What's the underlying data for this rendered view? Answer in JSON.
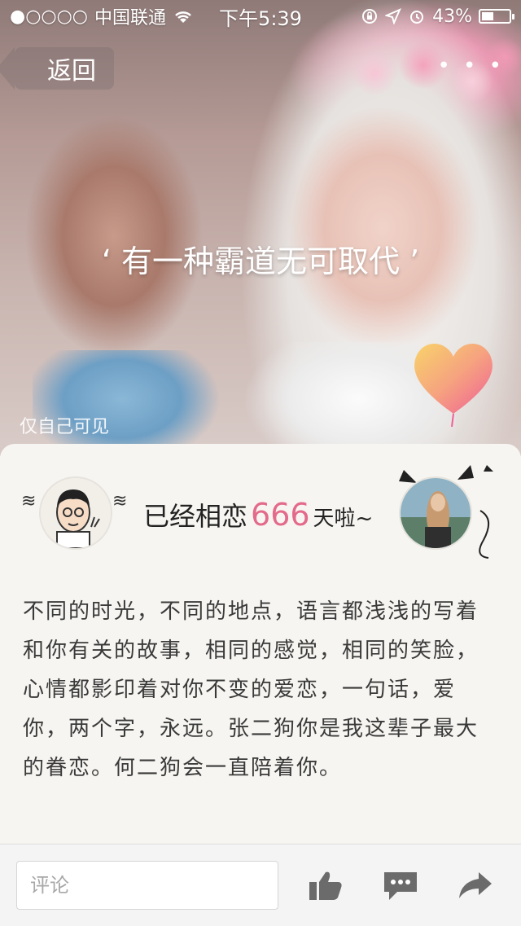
{
  "status_bar": {
    "signal": "●○○○○",
    "carrier": "中国联通",
    "wifi_icon": "wifi-icon",
    "time": "下午5:39",
    "battery_percent": "43%",
    "battery_level": 0.43
  },
  "header": {
    "back_label": "返回",
    "more_label": "• • •"
  },
  "photo": {
    "caption": "‘ 有一种霸道无可取代 ’",
    "privacy": "仅自己可见"
  },
  "love": {
    "prefix": "已经相恋",
    "days": "666",
    "suffix": "天啦~"
  },
  "message": "不同的时光，不同的地点，语言都浅浅的写着和你有关的故事，相同的感觉，相同的笑脸，心情都影印着对你不变的爱恋，一句话，爱你，两个字，永远。张二狗你是我这辈子最大的眷恋。何二狗会一直陪着你。",
  "bottom_bar": {
    "comment_placeholder": "评论"
  },
  "colors": {
    "accent_pink": "#e36a8a",
    "icon_gray": "#6b6b6b"
  }
}
